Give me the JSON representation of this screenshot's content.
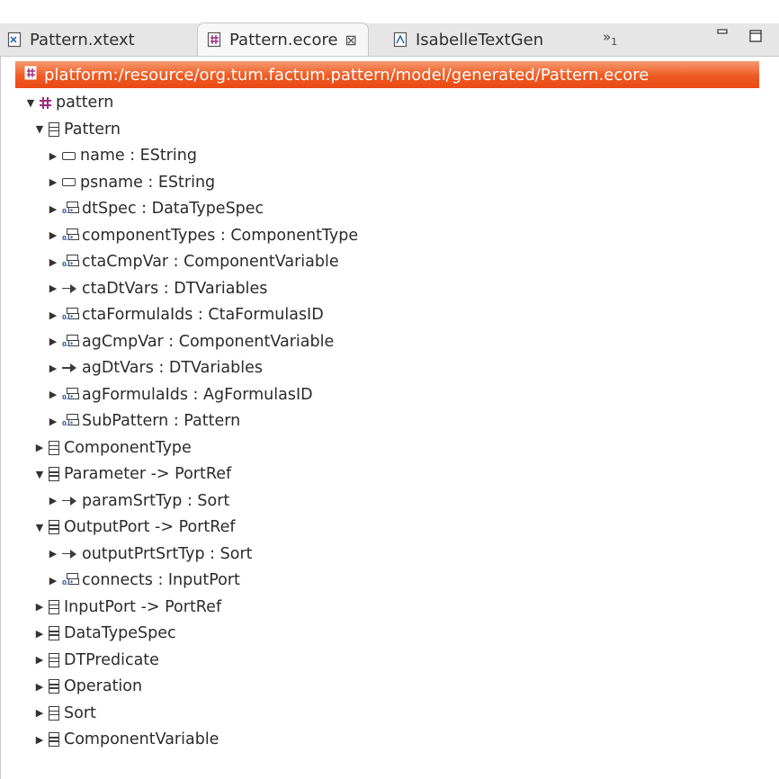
{
  "tabs": [
    {
      "label": "Pattern.xtext",
      "icon": "xtext-file-icon",
      "active": false
    },
    {
      "label": "Pattern.ecore",
      "icon": "ecore-file-icon",
      "active": true,
      "close": "⊠"
    },
    {
      "label": "IsabelleTextGen",
      "icon": "xtend-file-icon",
      "active": false
    }
  ],
  "overflow": {
    "symbol": "»",
    "count": "1"
  },
  "window_buttons": {
    "minimize": "▭",
    "maximize": "□"
  },
  "resource_path": "platform:/resource/org.tum.factum.pattern/model/generated/Pattern.ecore",
  "colors": {
    "resource_bar": "#ef5a22",
    "package_icon": "#9b2c7a",
    "tab_bar": "#e6e6e6"
  },
  "tree": [
    {
      "label": "pattern",
      "icon": "package-icon",
      "level": 0,
      "expanded": true
    },
    {
      "label": "Pattern",
      "icon": "class-icon",
      "level": 1,
      "expanded": true
    },
    {
      "label": "name : EString",
      "icon": "attribute-icon",
      "level": 2,
      "expanded": false
    },
    {
      "label": "psname : EString",
      "icon": "attribute-icon",
      "level": 2,
      "expanded": false
    },
    {
      "label": "dtSpec : DataTypeSpec",
      "icon": "multi-reference-icon",
      "level": 2,
      "expanded": false
    },
    {
      "label": "componentTypes : ComponentType",
      "icon": "multi-reference-icon",
      "level": 2,
      "expanded": false
    },
    {
      "label": "ctaCmpVar : ComponentVariable",
      "icon": "multi-reference-icon",
      "level": 2,
      "expanded": false
    },
    {
      "label": "ctaDtVars : DTVariables",
      "icon": "reference-icon",
      "level": 2,
      "expanded": false
    },
    {
      "label": "ctaFormulaIds : CtaFormulasID",
      "icon": "multi-reference-icon",
      "level": 2,
      "expanded": false
    },
    {
      "label": "agCmpVar : ComponentVariable",
      "icon": "multi-reference-icon",
      "level": 2,
      "expanded": false
    },
    {
      "label": "agDtVars : DTVariables",
      "icon": "reference-icon",
      "level": 2,
      "expanded": false
    },
    {
      "label": "agFormulaIds : AgFormulasID",
      "icon": "multi-reference-icon",
      "level": 2,
      "expanded": false
    },
    {
      "label": "SubPattern : Pattern",
      "icon": "multi-reference-icon",
      "level": 2,
      "expanded": false
    },
    {
      "label": "ComponentType",
      "icon": "class-icon",
      "level": 1,
      "expanded": false
    },
    {
      "label": "Parameter -> PortRef",
      "icon": "class-icon",
      "level": 1,
      "expanded": true
    },
    {
      "label": "paramSrtTyp : Sort",
      "icon": "reference-icon",
      "level": 2,
      "expanded": false
    },
    {
      "label": "OutputPort -> PortRef",
      "icon": "class-icon",
      "level": 1,
      "expanded": true
    },
    {
      "label": "outputPrtSrtTyp : Sort",
      "icon": "reference-icon",
      "level": 2,
      "expanded": false
    },
    {
      "label": "connects : InputPort",
      "icon": "multi-reference-icon",
      "level": 2,
      "expanded": false
    },
    {
      "label": "InputPort -> PortRef",
      "icon": "class-icon",
      "level": 1,
      "expanded": false
    },
    {
      "label": "DataTypeSpec",
      "icon": "class-icon",
      "level": 1,
      "expanded": false
    },
    {
      "label": "DTPredicate",
      "icon": "class-icon",
      "level": 1,
      "expanded": false
    },
    {
      "label": "Operation",
      "icon": "class-icon",
      "level": 1,
      "expanded": false
    },
    {
      "label": "Sort",
      "icon": "class-icon",
      "level": 1,
      "expanded": false
    },
    {
      "label": "ComponentVariable",
      "icon": "class-icon",
      "level": 1,
      "expanded": false
    }
  ]
}
